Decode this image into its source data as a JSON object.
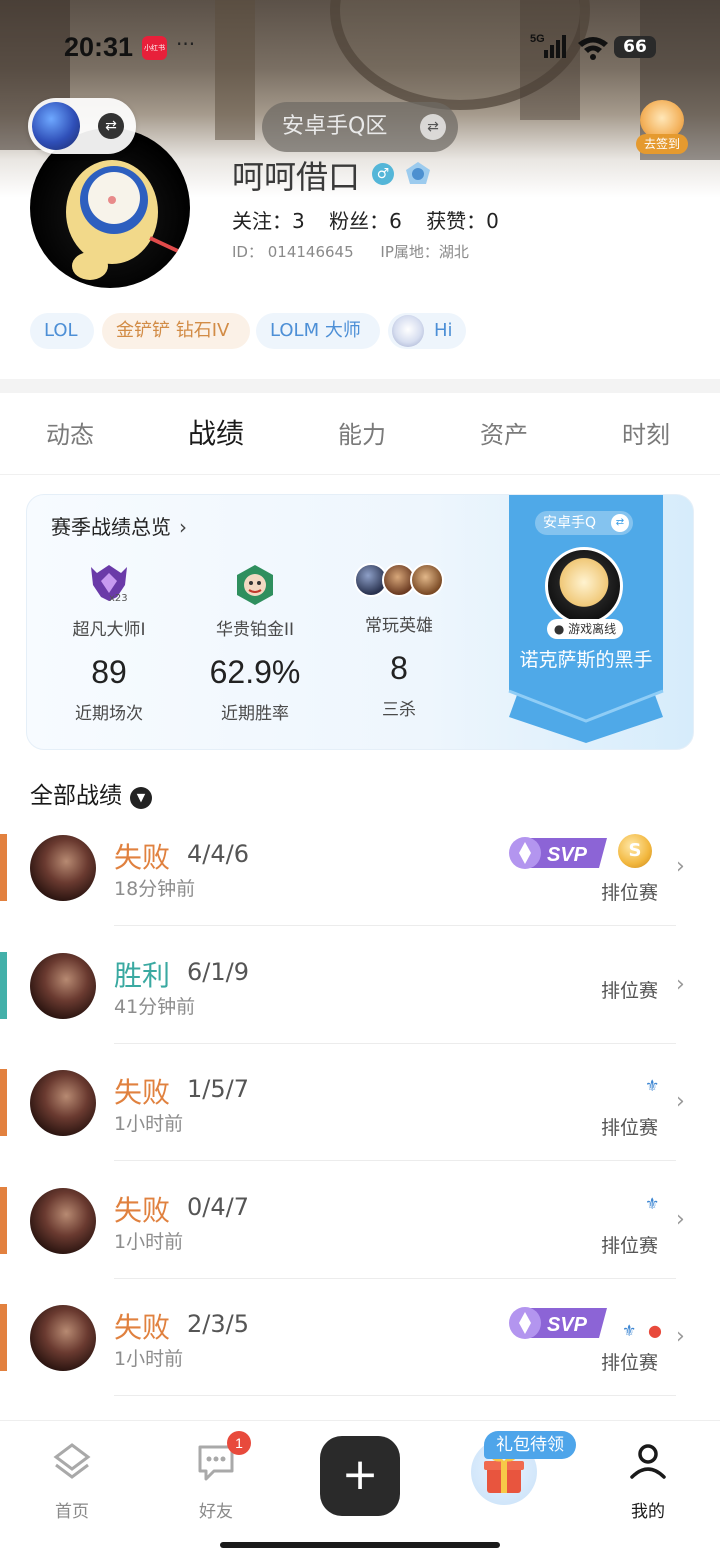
{
  "status_bar": {
    "time": "20:31",
    "app_badge": "小红书",
    "more": "···",
    "network": "5G",
    "battery": "66"
  },
  "header": {
    "server": "安卓手Q区",
    "checkin": "去签到",
    "nickname": "呵呵借口",
    "gender_symbol": "♂",
    "stats": {
      "following": "关注：3",
      "fans": "粉丝：6",
      "likes": "获赞：0"
    },
    "id_label": "ID：  014146645",
    "ip_label": "IP属地：湖北",
    "tags": [
      "LOL",
      "金铲铲 钻石IV",
      "LOLM 大师",
      "Hi"
    ]
  },
  "tabs": [
    {
      "label": "动态",
      "active": false
    },
    {
      "label": "战绩",
      "active": true
    },
    {
      "label": "能力",
      "active": false
    },
    {
      "label": "资产",
      "active": false
    },
    {
      "label": "时刻",
      "active": false
    }
  ],
  "season": {
    "title": "赛季战绩总览",
    "columns": [
      {
        "name": "超凡大师I",
        "badge": "x23",
        "value": "89",
        "sub": "近期场次"
      },
      {
        "name": "华贵铂金II",
        "value": "62.9%",
        "sub": "近期胜率"
      },
      {
        "name": "常玩英雄",
        "value": "8",
        "sub": "三杀"
      }
    ],
    "banner": {
      "server": "安卓手Q",
      "status": "● 游戏离线",
      "name": "诺克萨斯的黑手"
    }
  },
  "records": {
    "header": "全部战绩",
    "items": [
      {
        "result": "失败",
        "type": "lose",
        "kda": "4/4/6",
        "time": "18分钟前",
        "mode": "排位赛"
      },
      {
        "result": "胜利",
        "type": "win",
        "kda": "6/1/9",
        "time": "41分钟前",
        "mode": "排位赛"
      },
      {
        "result": "失败",
        "type": "lose",
        "kda": "1/5/7",
        "time": "1小时前",
        "mode": "排位赛"
      },
      {
        "result": "失败",
        "type": "lose",
        "kda": "0/4/7",
        "time": "1小时前",
        "mode": "排位赛"
      },
      {
        "result": "失败",
        "type": "lose",
        "kda": "2/3/5",
        "time": "1小时前",
        "mode": "排位赛"
      }
    ],
    "svp_label": "SVP",
    "coin_label": "S"
  },
  "bottom_nav": {
    "home": "首页",
    "friends": "好友",
    "friends_badge": "1",
    "plus": "+",
    "gift_tag": "礼包待领",
    "mine": "我的"
  },
  "colors": {
    "lose": "#e2813f",
    "win": "#43b0a9",
    "accent": "#4ea5ea"
  }
}
